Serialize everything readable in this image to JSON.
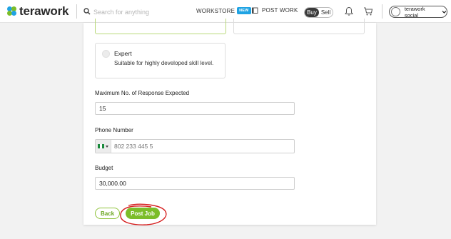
{
  "header": {
    "logo_text": "terawork",
    "search_placeholder": "Search for anything",
    "workstore_label": "WORKSTORE",
    "new_badge": "NEW",
    "postwork_label": "POST WORK",
    "buy_label": "Buy",
    "sell_label": "Sell",
    "account_name": "terawork social"
  },
  "form": {
    "expert_title": "Expert",
    "expert_desc": "Suitable for highly developed skill level.",
    "max_response_label": "Maximum No. of Response Expected",
    "max_response_value": "15",
    "phone_label": "Phone Number",
    "phone_placeholder": "802 233 445 5",
    "budget_label": "Budget",
    "budget_value": "30,000.00",
    "back_label": "Back",
    "post_job_label": "Post Job"
  },
  "colors": {
    "accent_green": "#7cbd29",
    "new_badge_blue": "#1fa3e3",
    "annotation_red": "#d62020"
  },
  "icons": [
    "search-icon",
    "document-icon",
    "bell-icon",
    "cart-icon",
    "avatar",
    "chevron-down-icon",
    "nigeria-flag-icon"
  ]
}
